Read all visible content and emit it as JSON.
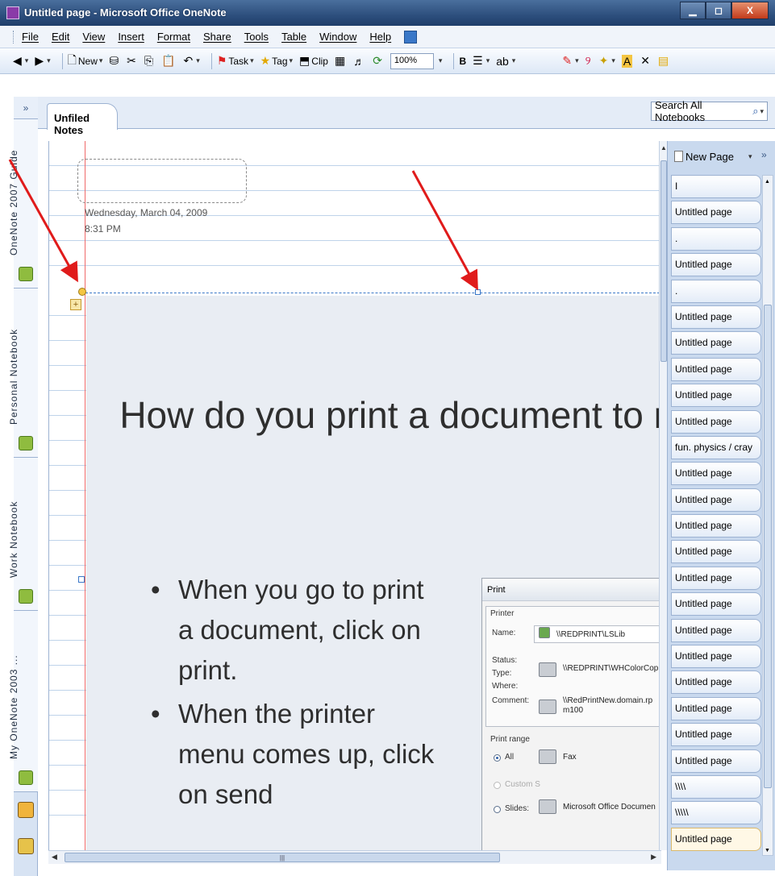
{
  "window": {
    "title": "Untitled page - Microsoft Office OneNote",
    "min_label": "▁",
    "max_label": "◻",
    "close_label": "X"
  },
  "menu": [
    "File",
    "Edit",
    "View",
    "Insert",
    "Format",
    "Share",
    "Tools",
    "Table",
    "Window",
    "Help"
  ],
  "toolbar": {
    "new_label": "New",
    "task_label": "Task",
    "tag_label": "Tag",
    "clip_label": "Clip",
    "zoom": "100%",
    "bold_label": "B"
  },
  "nav": {
    "collapse": "»",
    "notebooks": [
      "OneNote 2007 Guide",
      "Personal Notebook",
      "Work Notebook",
      "My OneNote 2003 ..."
    ]
  },
  "section": {
    "tab_label": "Unfiled Notes",
    "search_placeholder": "Search All Notebooks"
  },
  "page": {
    "date": "Wednesday, March 04, 2009",
    "time": "8:31 PM",
    "move_glyph": "+"
  },
  "slide": {
    "title": "How do you print a document to note?",
    "bullets": [
      "When you go to print a document, click on print.",
      "When the printer menu comes up, click on send"
    ]
  },
  "print_dialog": {
    "title": "Print",
    "printer_group": "Printer",
    "name_label": "Name:",
    "name_value": "\\\\REDPRINT\\LSLib",
    "status_label": "Status:",
    "type_label": "Type:",
    "where_label": "Where:",
    "comment_label": "Comment:",
    "printer_1": "\\\\REDPRINT\\WHColorCop",
    "printer_2": "\\\\RedPrintNew.domain.rp m100",
    "printer_3": "Fax",
    "printer_4": "Microsoft Office Documen",
    "range_group": "Print range",
    "range_all": "All",
    "range_custom": "Custom S",
    "range_slides": "Slides:"
  },
  "page_panel": {
    "new_page": "New Page",
    "expand": "»",
    "pages": [
      "I",
      "Untitled page",
      ".",
      "Untitled page",
      ".",
      "Untitled page",
      "Untitled page",
      "Untitled page",
      "Untitled page",
      "Untitled page",
      "fun. physics / cray",
      "Untitled page",
      "Untitled page",
      "Untitled page",
      "Untitled page",
      "Untitled page",
      "Untitled page",
      "Untitled page",
      "Untitled page",
      "Untitled page",
      "Untitled page",
      "Untitled page",
      "Untitled page",
      "\\\\\\\\",
      "\\\\\\\\\\",
      "Untitled page"
    ],
    "active_index": 25
  },
  "colors": {
    "title_bar": "#2d4f7d",
    "annotation_arrow": "#e01b1b",
    "margin_line": "#ef6a6a"
  }
}
